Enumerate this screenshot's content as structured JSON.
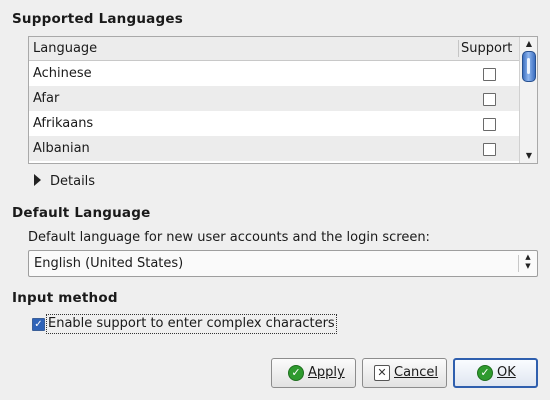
{
  "sections": {
    "supported_languages": "Supported Languages",
    "default_language": "Default Language",
    "input_method": "Input method"
  },
  "table": {
    "columns": [
      "Language",
      "Support"
    ],
    "rows": [
      {
        "language": "Achinese",
        "supported": false
      },
      {
        "language": "Afar",
        "supported": false
      },
      {
        "language": "Afrikaans",
        "supported": false
      },
      {
        "language": "Albanian",
        "supported": false
      }
    ]
  },
  "details": {
    "label": "Details",
    "expanded": false
  },
  "default_language": {
    "description": "Default language for new user accounts and the login screen:",
    "selected": "English (United States)"
  },
  "input_method": {
    "checkbox_label": "Enable support to enter complex characters",
    "checked": true
  },
  "buttons": {
    "apply": "Apply",
    "cancel": "Cancel",
    "ok": "OK"
  },
  "icons": {
    "apply": "check-circle-icon",
    "cancel": "cancel-x-icon",
    "ok": "check-circle-icon"
  },
  "colors": {
    "accent": "#2f63b8",
    "ok_icon": "#2e9a2e"
  }
}
